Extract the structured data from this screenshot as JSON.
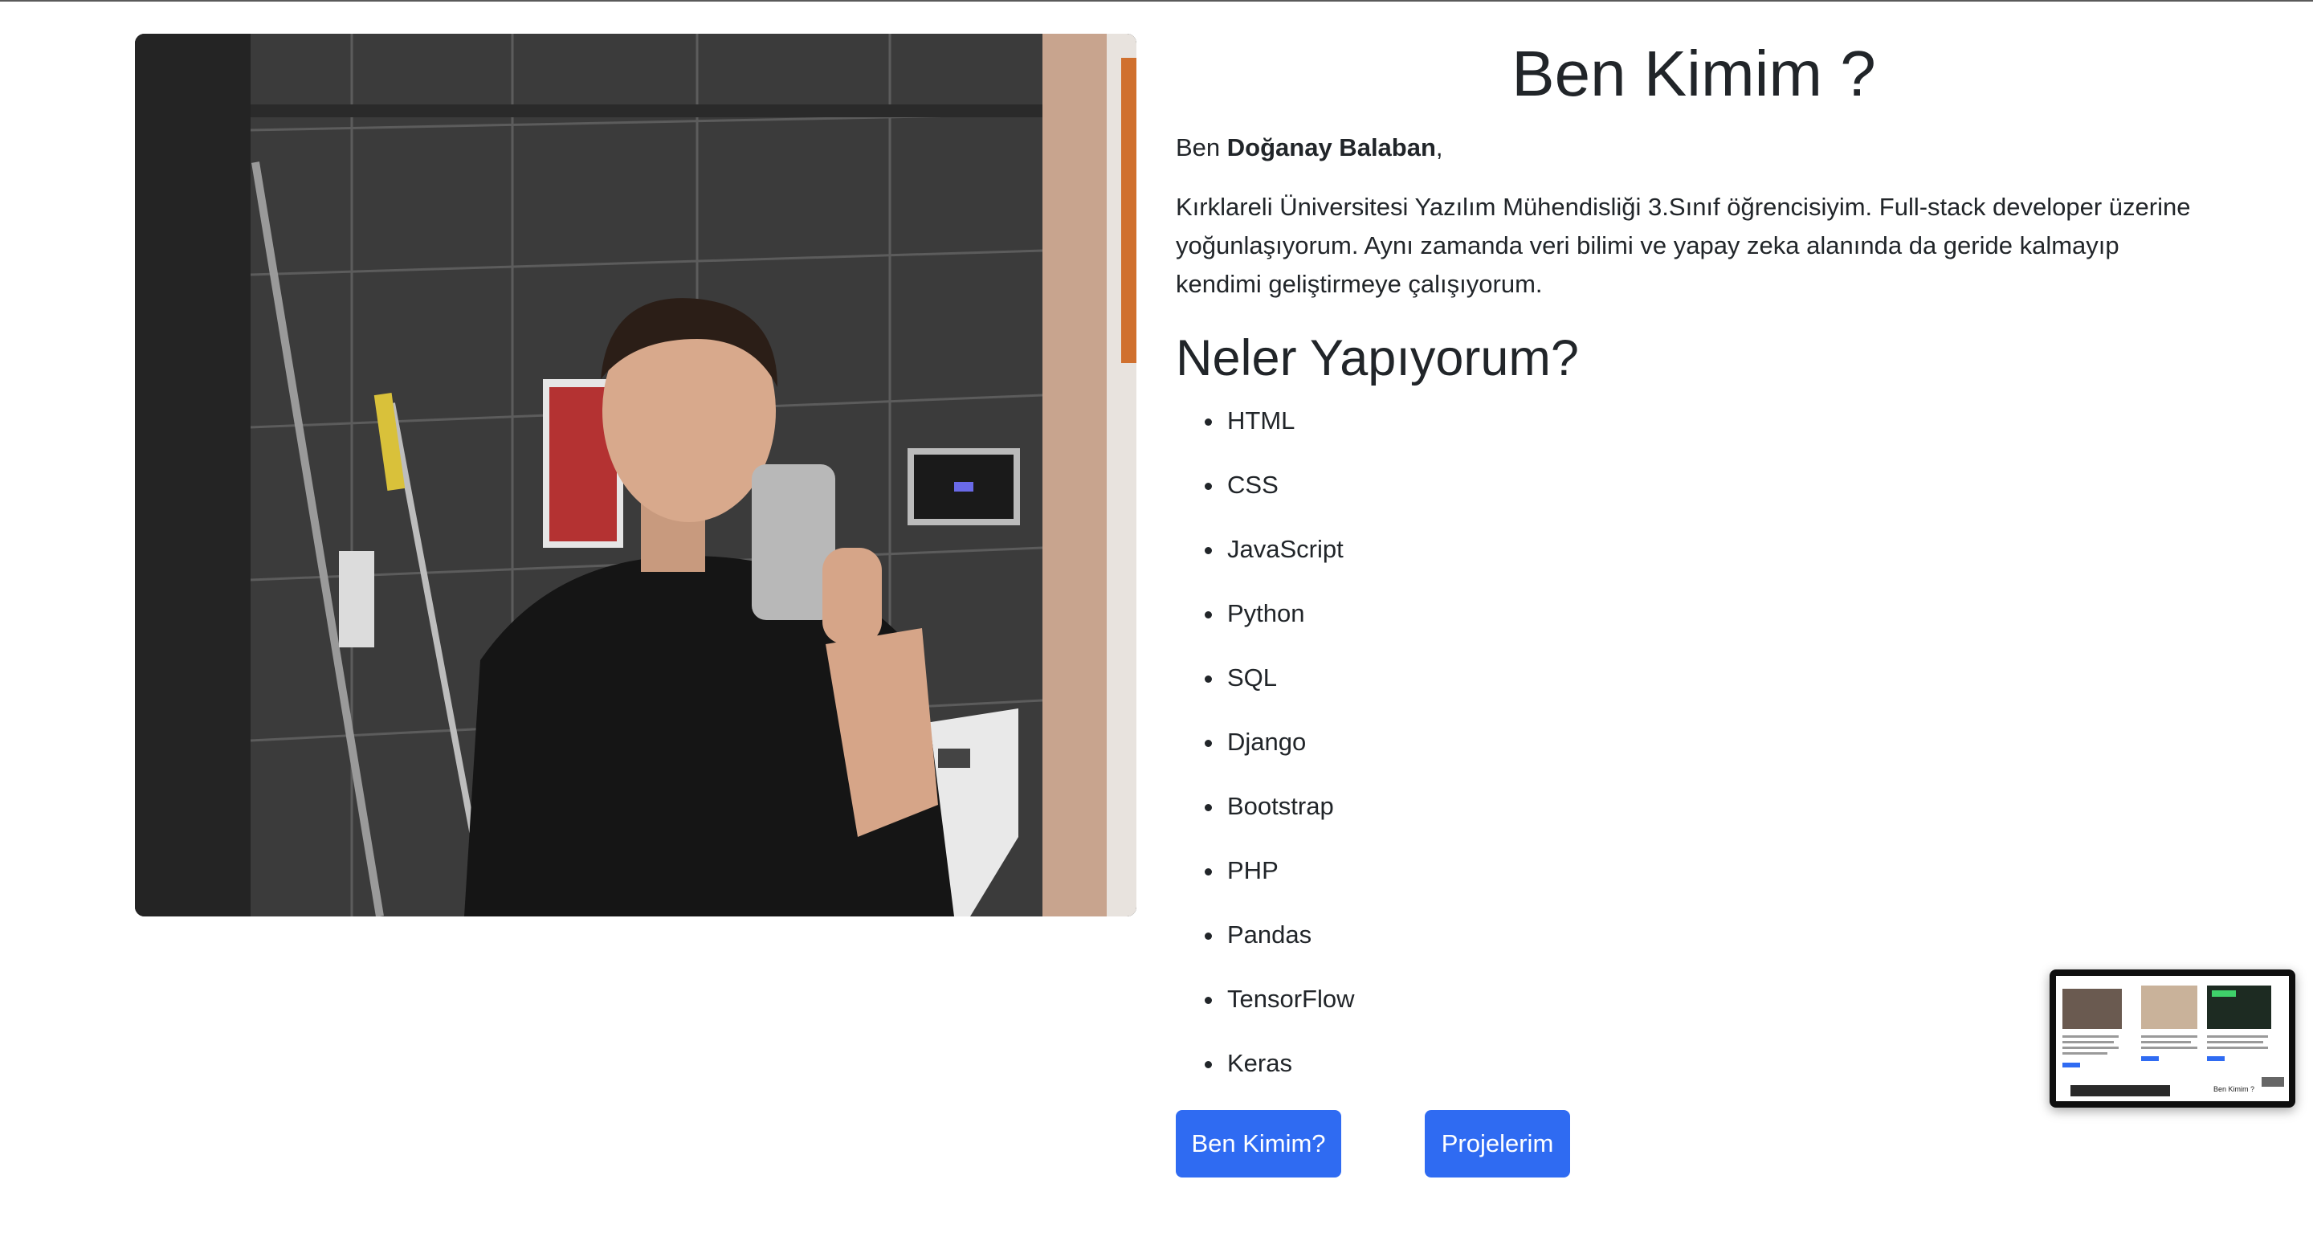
{
  "about": {
    "title": "Ben Kimim ?",
    "intro_prefix": "Ben ",
    "name": "Doğanay Balaban",
    "intro_suffix": ",",
    "paragraph": "Kırklareli Üniversitesi Yazılım Mühendisliği 3.Sınıf öğrencisiyim. Full-stack developer üzerine yoğunlaşıyorum. Aynı zamanda veri bilimi ve yapay zeka alanında da geride kalmayıp kendimi geliştirmeye çalışıyorum."
  },
  "skills": {
    "heading": "Neler Yapıyorum?",
    "items": [
      "HTML",
      "CSS",
      "JavaScript",
      "Python",
      "SQL",
      "Django",
      "Bootstrap",
      "PHP",
      "Pandas",
      "TensorFlow",
      "Keras"
    ]
  },
  "buttons": {
    "about_label": "Ben Kimim?",
    "projects_label": "Projelerim"
  },
  "thumbnail": {
    "caption": "Ben Kimim ?"
  },
  "colors": {
    "button": "#2f6bf2",
    "text": "#212529"
  }
}
